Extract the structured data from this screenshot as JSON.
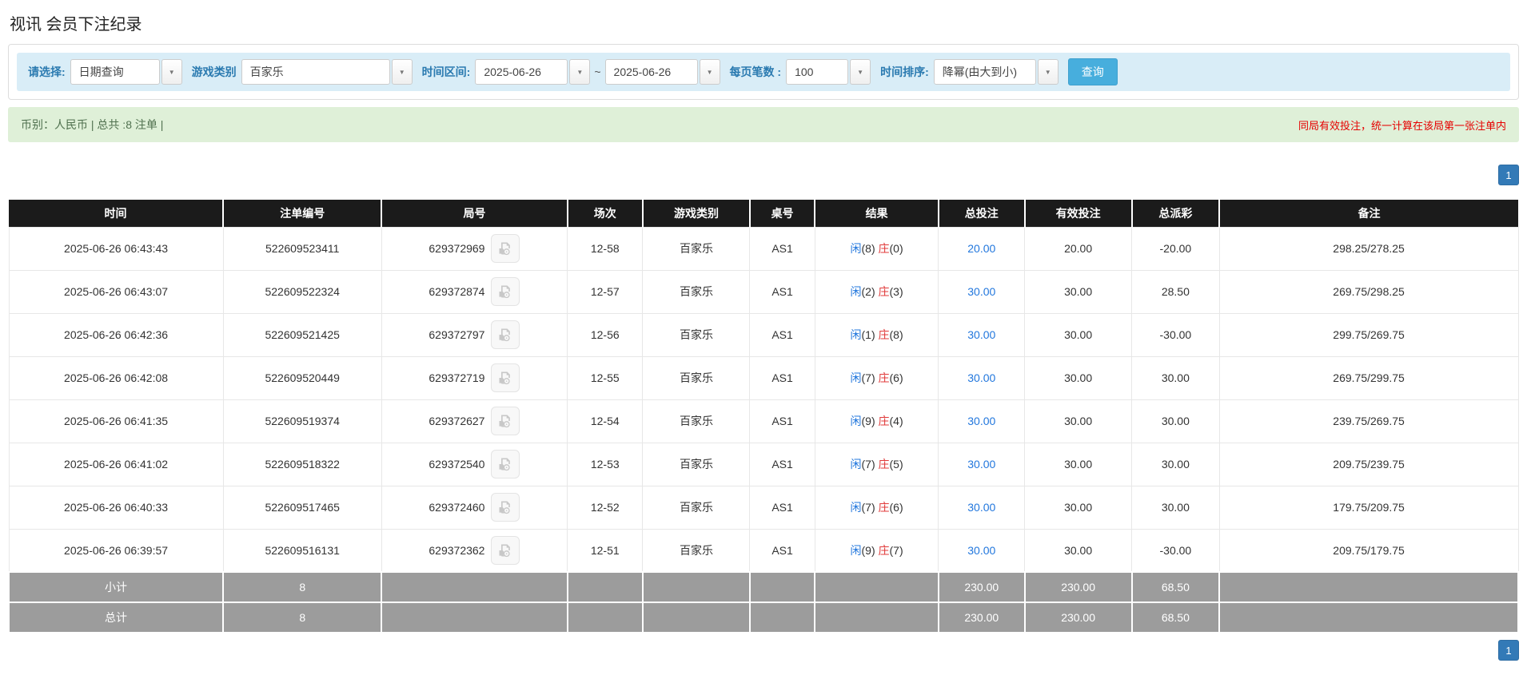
{
  "page": {
    "title": "视讯 会员下注纪录"
  },
  "colors": {
    "filter_bar_bg": "#d9edf7",
    "label_blue": "#2a7ab0",
    "search_button_bg": "#47aedd",
    "summary_bg": "#dff0d8",
    "summary_text_green": "#50714f",
    "notice_red": "#e60000",
    "header_bg": "#1b1b1b",
    "footer_bg": "#9c9c9c",
    "link_blue": "#2277dd",
    "banker_red": "#e03a3a",
    "pager_blue": "#337ab7"
  },
  "icons": {
    "dropdown_caret": "▼",
    "video": "video-camera-icon"
  },
  "filters": {
    "select_label": "请选择:",
    "select_value": "日期查询",
    "game_type_label": "游戏类别",
    "game_type_value": "百家乐",
    "time_range_label": "时间区间:",
    "date_from": "2025-06-26",
    "date_separator": "~",
    "date_to": "2025-06-26",
    "page_size_label": "每页笔数 :",
    "page_size_value": "100",
    "sort_label": "时间排序:",
    "sort_value": "降幂(由大到小)",
    "search_button": "查询"
  },
  "summary": {
    "left": "币别：人民币 | 总共 :8 注单 |",
    "right_notice": "同局有效投注，统一计算在该局第一张注单内"
  },
  "pagination": {
    "page": "1"
  },
  "table": {
    "headers": [
      "时间",
      "注单编号",
      "局号",
      "场次",
      "游戏类别",
      "桌号",
      "结果",
      "总投注",
      "有效投注",
      "总派彩",
      "备注"
    ],
    "rows": [
      {
        "time": "2025-06-26 06:43:43",
        "bet_id": "522609523411",
        "round_id": "629372969",
        "session": "12-58",
        "game_type": "百家乐",
        "table_no": "AS1",
        "result": {
          "player_label": "闲",
          "player_value": "(8)",
          "banker_label": "庄",
          "banker_value": "(0)"
        },
        "total_bet": "20.00",
        "valid_bet": "20.00",
        "payout": "-20.00",
        "remark": "298.25/278.25"
      },
      {
        "time": "2025-06-26 06:43:07",
        "bet_id": "522609522324",
        "round_id": "629372874",
        "session": "12-57",
        "game_type": "百家乐",
        "table_no": "AS1",
        "result": {
          "player_label": "闲",
          "player_value": "(2)",
          "banker_label": "庄",
          "banker_value": "(3)"
        },
        "total_bet": "30.00",
        "valid_bet": "30.00",
        "payout": "28.50",
        "remark": "269.75/298.25"
      },
      {
        "time": "2025-06-26 06:42:36",
        "bet_id": "522609521425",
        "round_id": "629372797",
        "session": "12-56",
        "game_type": "百家乐",
        "table_no": "AS1",
        "result": {
          "player_label": "闲",
          "player_value": "(1)",
          "banker_label": "庄",
          "banker_value": "(8)"
        },
        "total_bet": "30.00",
        "valid_bet": "30.00",
        "payout": "-30.00",
        "remark": "299.75/269.75"
      },
      {
        "time": "2025-06-26 06:42:08",
        "bet_id": "522609520449",
        "round_id": "629372719",
        "session": "12-55",
        "game_type": "百家乐",
        "table_no": "AS1",
        "result": {
          "player_label": "闲",
          "player_value": "(7)",
          "banker_label": "庄",
          "banker_value": "(6)"
        },
        "total_bet": "30.00",
        "valid_bet": "30.00",
        "payout": "30.00",
        "remark": "269.75/299.75"
      },
      {
        "time": "2025-06-26 06:41:35",
        "bet_id": "522609519374",
        "round_id": "629372627",
        "session": "12-54",
        "game_type": "百家乐",
        "table_no": "AS1",
        "result": {
          "player_label": "闲",
          "player_value": "(9)",
          "banker_label": "庄",
          "banker_value": "(4)"
        },
        "total_bet": "30.00",
        "valid_bet": "30.00",
        "payout": "30.00",
        "remark": "239.75/269.75"
      },
      {
        "time": "2025-06-26 06:41:02",
        "bet_id": "522609518322",
        "round_id": "629372540",
        "session": "12-53",
        "game_type": "百家乐",
        "table_no": "AS1",
        "result": {
          "player_label": "闲",
          "player_value": "(7)",
          "banker_label": "庄",
          "banker_value": "(5)"
        },
        "total_bet": "30.00",
        "valid_bet": "30.00",
        "payout": "30.00",
        "remark": "209.75/239.75"
      },
      {
        "time": "2025-06-26 06:40:33",
        "bet_id": "522609517465",
        "round_id": "629372460",
        "session": "12-52",
        "game_type": "百家乐",
        "table_no": "AS1",
        "result": {
          "player_label": "闲",
          "player_value": "(7)",
          "banker_label": "庄",
          "banker_value": "(6)"
        },
        "total_bet": "30.00",
        "valid_bet": "30.00",
        "payout": "30.00",
        "remark": "179.75/209.75"
      },
      {
        "time": "2025-06-26 06:39:57",
        "bet_id": "522609516131",
        "round_id": "629372362",
        "session": "12-51",
        "game_type": "百家乐",
        "table_no": "AS1",
        "result": {
          "player_label": "闲",
          "player_value": "(9)",
          "banker_label": "庄",
          "banker_value": "(7)"
        },
        "total_bet": "30.00",
        "valid_bet": "30.00",
        "payout": "-30.00",
        "remark": "209.75/179.75"
      }
    ],
    "subtotal": {
      "label": "小计",
      "count": "8",
      "total_bet": "230.00",
      "valid_bet": "230.00",
      "payout": "68.50"
    },
    "total": {
      "label": "总计",
      "count": "8",
      "total_bet": "230.00",
      "valid_bet": "230.00",
      "payout": "68.50"
    }
  }
}
